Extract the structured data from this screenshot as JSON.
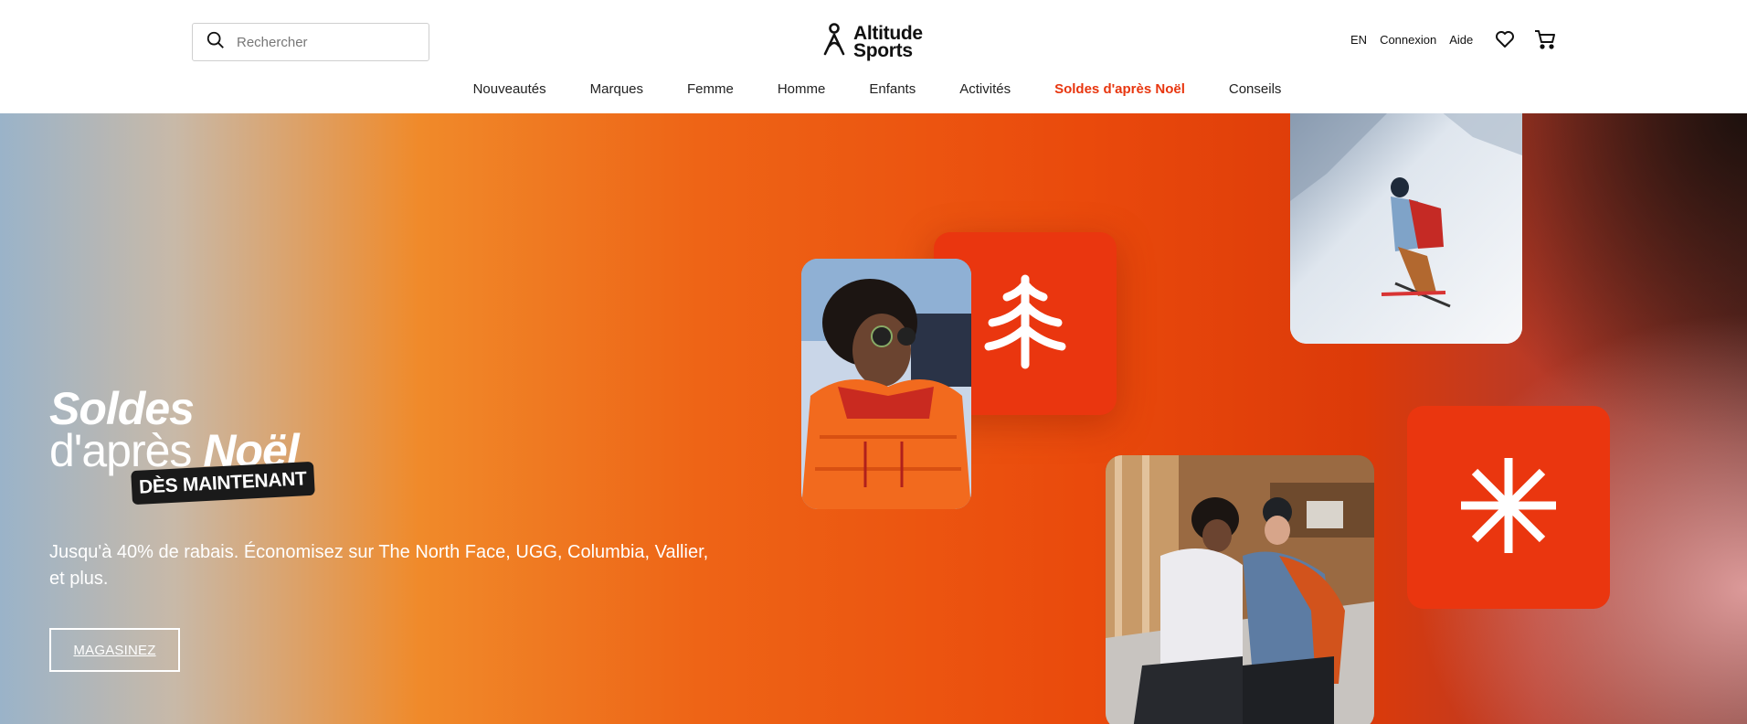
{
  "header": {
    "search_placeholder": "Rechercher",
    "logo_line1": "Altitude",
    "logo_line2": "Sports",
    "lang": "EN",
    "login": "Connexion",
    "help": "Aide"
  },
  "nav": {
    "items": [
      {
        "label": "Nouveautés"
      },
      {
        "label": "Marques"
      },
      {
        "label": "Femme"
      },
      {
        "label": "Homme"
      },
      {
        "label": "Enfants"
      },
      {
        "label": "Activités"
      },
      {
        "label": "Soldes d'après Noël"
      },
      {
        "label": "Conseils"
      }
    ]
  },
  "hero": {
    "title_line1": "Soldes",
    "title_line2a": "d'après ",
    "title_line2b": "Noël",
    "tag": "DÈS MAINTENANT",
    "subtitle": "Jusqu'à 40% de rabais. Économisez sur The North Face, UGG, Columbia, Vallier, et plus.",
    "cta": "MAGASINEZ"
  },
  "colors": {
    "accent": "#e8360f",
    "tile": "#ea360f"
  },
  "icons": [
    "search-icon",
    "logo-icon",
    "heart-icon",
    "cart-icon",
    "tree-icon",
    "asterisk-icon"
  ]
}
